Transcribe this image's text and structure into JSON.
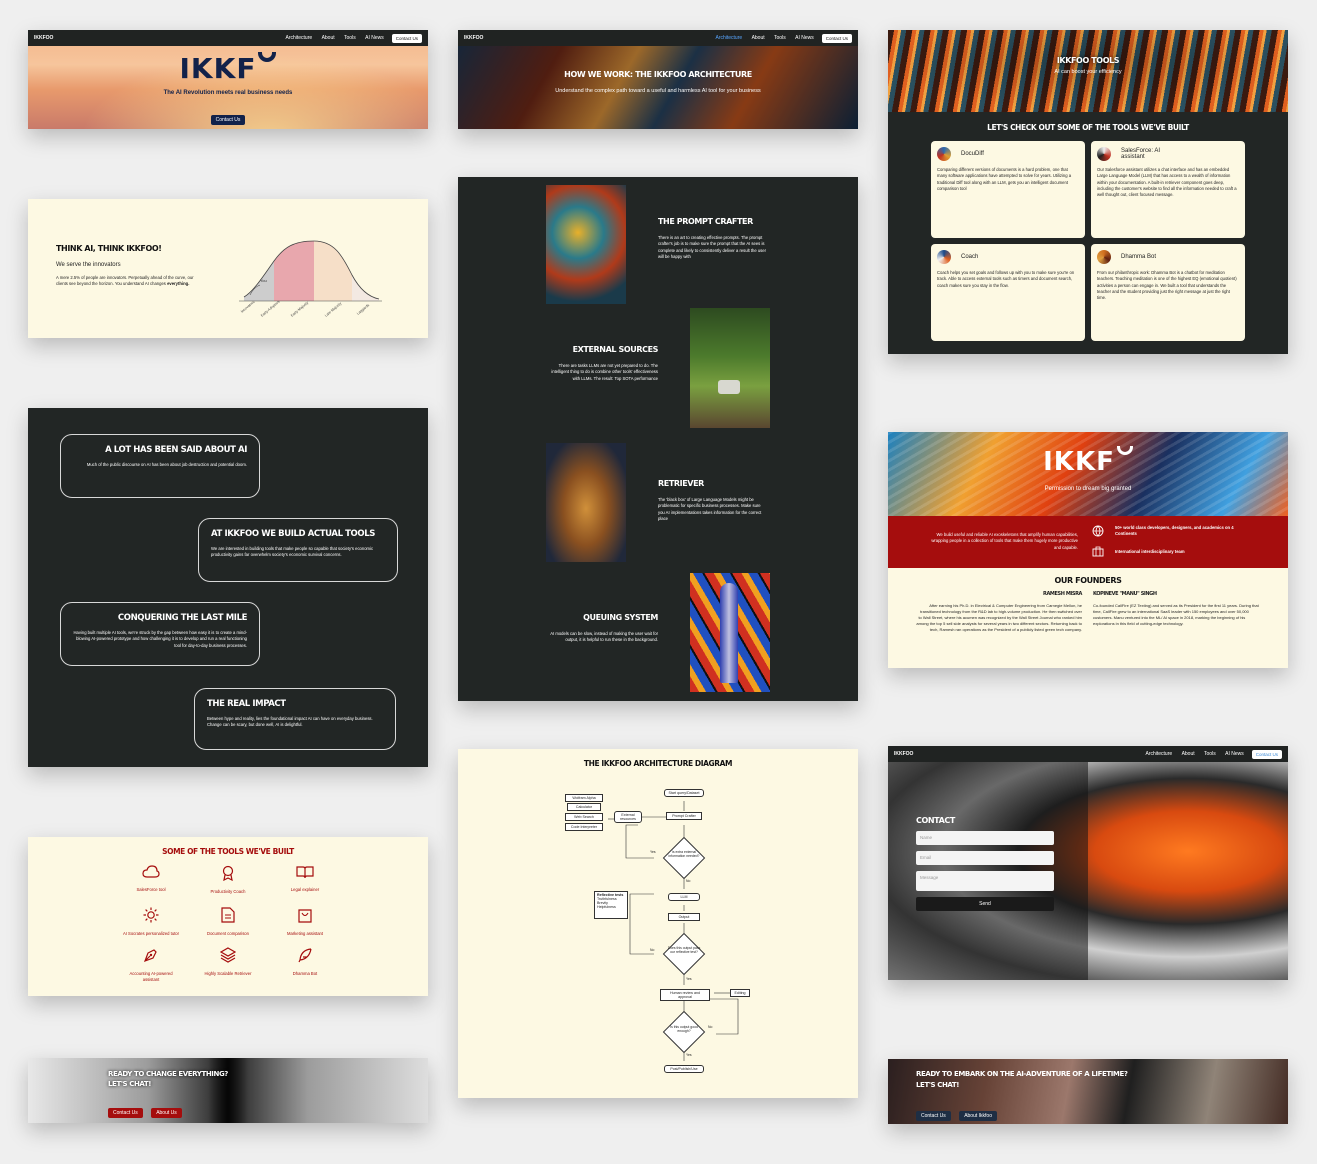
{
  "nav": {
    "brand": "IKKFOO",
    "links": [
      "Architecture",
      "About",
      "Tools",
      "AI News"
    ],
    "contact": "Contact Us"
  },
  "hero": {
    "logo": "IKKF",
    "tagline": "The AI Revolution meets real business needs",
    "button": "Contact Us"
  },
  "think": {
    "title": "THINK AI, THINK IKKFOO!",
    "subtitle": "We serve the innovators",
    "body": "A mere 2.5% of people are innovators. Perpetually ahead of the curve, our clients see beyond the horizon.  You understand AI changes",
    "body_bold": "everything.",
    "curve_you": "You",
    "curve_labels": [
      "Innovators",
      "Early Adopters",
      "Early Majority",
      "Late Majority",
      "Laggards"
    ]
  },
  "said": [
    {
      "title": "A LOT HAS BEEN SAID ABOUT AI",
      "body": "Much of the public discourse on AI has been about job destruction and potential doom."
    },
    {
      "title": "AT IKKFOO WE BUILD ACTUAL TOOLS",
      "body": "We are interested in building tools that make people so capable that society's economic productivity gains far overwhelm society's economic survival concerns."
    },
    {
      "title": "CONQUERING THE LAST MILE",
      "body": "Having built multiple AI tools, we're struck by the gap between how easy it is to create a mind-blowing AI-powered prototype and how challenging it is to develop and run a real functioning tool for day-to-day business processes."
    },
    {
      "title": "THE REAL IMPACT",
      "body": "Between hype and reality, lies the foundational impact AI can have on everyday business. Change can be scary, but done well, AI is delightful."
    }
  ],
  "tools_built": {
    "title": "SOME OF THE TOOLS WE'VE BUILT",
    "items": [
      {
        "icon": "cloud-icon",
        "label": "SalesForce tool"
      },
      {
        "icon": "award-icon",
        "label": "Productivity Coach"
      },
      {
        "icon": "book-icon",
        "label": "Legal explainer"
      },
      {
        "icon": "sun-icon",
        "label": "AI Socrates personalized tutor"
      },
      {
        "icon": "document-icon",
        "label": "Document comparison"
      },
      {
        "icon": "shopping-bag-icon",
        "label": "Marketing assistant"
      },
      {
        "icon": "pen-tool-icon",
        "label": "Accounting AI-powered assistant"
      },
      {
        "icon": "layers-icon",
        "label": "Highly Scalable Retriever"
      },
      {
        "icon": "feather-icon",
        "label": "Dhamma Bot"
      }
    ]
  },
  "cta1": {
    "title": "READY TO CHANGE EVERYTHING?",
    "subtitle": "LET'S CHAT!",
    "btn1": "Contact Us",
    "btn2": "About Us"
  },
  "arch_hero": {
    "title": "HOW WE WORK: THE IKKFOO ARCHITECTURE",
    "subtitle": "Understand the complex path toward a useful and harmless AI tool for your business"
  },
  "arch_items": [
    {
      "title": "THE PROMPT CRAFTER",
      "body": "There is an art to creating effective prompts. The prompt crafter's job is to make sure the prompt that the AI sees is complete and likely to consistently deliver a result the user will be happy with"
    },
    {
      "title": "EXTERNAL SOURCES",
      "body": "There are tasks LLMs are not yet prepared to do. The intelligent thing to do is combine other tools' effectiveness with LLMs. The result: Top SOTA performance"
    },
    {
      "title": "RETRIEVER",
      "body": "The 'black box' of Large Language Models might be problematic for specific business processes. Make sure you AI implementations takes information for the correct place"
    },
    {
      "title": "QUEUING SYSTEM",
      "body": "AI models can be slow, instead of making the user wait for output, it is helpful to run these in the background."
    }
  ],
  "diagram": {
    "title": "THE IKKFOO ARCHITECTURE DIAGRAM",
    "sources": [
      "Wolfram Alpha",
      "Calculator",
      "Web Search",
      "Code Interpreter"
    ],
    "external": "External resources",
    "start": "Start query/Dataset",
    "prompt": "Prompt Crafter",
    "q1": "Is extra external information needed?",
    "yes": "Yes",
    "no": "No",
    "llm": "LLM",
    "output": "Output",
    "reflect_title": "Reflective tests",
    "reflect_items": [
      "Truthfulness",
      "Brevity",
      "Helpfulness"
    ],
    "q2": "Does this output pass our reflective test?",
    "review": "Human review and approval",
    "editing": "Editing",
    "q3": "Is this output good enough?",
    "end": "Post/Publish/Use"
  },
  "tools_page": {
    "hero_title": "IKKFOO TOOLS",
    "hero_subtitle": "AI can boost your efficiency",
    "section_title": "LET'S CHECK OUT SOME OF THE TOOLS WE'VE BUILT",
    "cards": [
      {
        "name": "DocuDiff",
        "body": "Comparing different versions of documents is a hard problem, one that many software applications have attempted to solve for years. Utilizing a traditional Diff tool along with an LLM, gets you an intelligent document comparison tool"
      },
      {
        "name": "SalesForce: AI assistant",
        "body": "Our Salesforce assistant utilizes a chat interface and has an embedded Large Language Model (LLM) that has access to a wealth of information within your documentation. A built-in retriever component goes deep, including the customer's website to find all the information needed to craft a well thought out, client focused message."
      },
      {
        "name": "Coach",
        "body": "Coach helps you set goals and follows up with you to make sure you're on track. Able to access external tools such as timers and document search, coach makes sure you stay in the flow."
      },
      {
        "name": "Dhamma Bot",
        "body": "From our philanthropic work: Dhamma Bot is a chatbot for meditation teachers. Teaching meditation is one of the highest EQ (emotional quotient) activities a person can engage in. We built a tool that understands the teacher and the student providing just the right message at just the right time."
      }
    ]
  },
  "about": {
    "logo": "IKKF",
    "tagline": "Permission to dream big granted",
    "mission": "We build useful and reliable AI exoskeletons that amplify human capabilities, wrapping people in a collection of tools that make them hugely more productive and capable.",
    "stat1": "50+ world class developers, designers, and academics on 4 Continents",
    "stat2": "International interdisciplinary team",
    "founders_title": "OUR FOUNDERS",
    "founders": [
      {
        "name": "RAMESH MISRA",
        "bio": "After earning his Ph.D. in Electrical & Computer Engineering from Carnegie Mellon, he transitioned technology from the R&D lab to high-volume production. He then switched over to Wall Street, where his acumen was recognized by the Wall Street Journal who ranked him among the top 5 sell side analysts for several years in two different sectors. Returning back to tech, Ramesh ran operations as the President of a publicly listed green tech company."
      },
      {
        "name": "KOPINEVE \"MANU\" SINGH",
        "bio": "Co-founded CallFire (EZ Texting) and served as its President for the first 11 years. During that time, CallFire grew to an international SaaS leader with 150 employees and over 50,000 customers. Manu ventured into the ML/ AI space in 2018, marking the beginning of his explorations in this field of cutting-edge technology."
      }
    ]
  },
  "contact": {
    "title": "CONTACT",
    "name_ph": "Name",
    "email_ph": "Email",
    "message_ph": "Message",
    "send": "Send"
  },
  "cta2": {
    "title": "READY TO EMBARK ON THE AI-ADVENTURE OF A LIFETIME?",
    "subtitle": "LET'S CHAT!",
    "btn1": "Contact Us",
    "btn2": "About Ikkfoo"
  },
  "colors": {
    "accent_red": "#a50d0d",
    "navy": "#12224a",
    "dark_bg": "#222625",
    "cream": "#fdf9e3"
  }
}
